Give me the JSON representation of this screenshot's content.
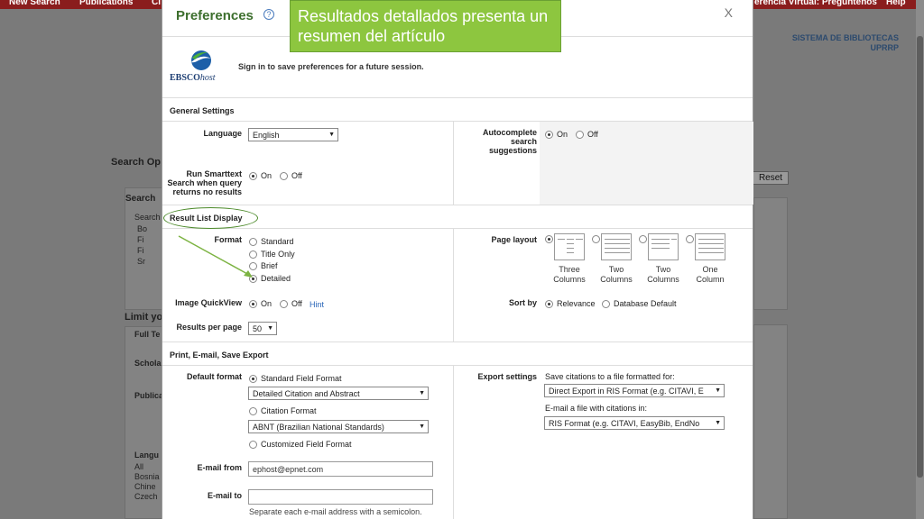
{
  "background": {
    "top_nav": [
      "New Search",
      "Publications",
      "Ci",
      "erencia Virtual: Pregúntenos",
      "Help"
    ],
    "system_name": [
      "SISTEMA DE BIBLIOTECAS",
      "UPRRP"
    ],
    "search_options_heading": "Search Op",
    "search_label": "Search",
    "search_modes": [
      "Search",
      "Bo",
      "Fi",
      "Fi",
      "Sr"
    ],
    "reset_label": "Reset",
    "limit_heading": "Limit yo",
    "limits": [
      "Full Te",
      "Schola",
      "Publica"
    ],
    "language_label": "Langu",
    "languages": [
      "All",
      "Bosnia",
      "Chine",
      "Czech"
    ]
  },
  "modal": {
    "title": "Preferences",
    "help": "?",
    "close": "X",
    "logo_main": "EBSCO",
    "logo_sub": "host",
    "signin_text": "Sign in to save preferences for a future session.",
    "general": {
      "title": "General Settings",
      "language_label": "Language",
      "language_value": "English",
      "autocomplete_label": [
        "Autocomplete",
        "search",
        "suggestions"
      ],
      "autocomplete_on": "On",
      "autocomplete_off": "Off",
      "smarttext_label": [
        "Run Smarttext",
        "Search when query",
        "returns no results"
      ],
      "smarttext_on": "On",
      "smarttext_off": "Off"
    },
    "result_list": {
      "title": "Result List Display",
      "format_label": "Format",
      "formats": [
        "Standard",
        "Title Only",
        "Brief",
        "Detailed"
      ],
      "page_layout_label": "Page layout",
      "layouts": [
        [
          "Three",
          "Columns"
        ],
        [
          "Two",
          "Columns"
        ],
        [
          "Two",
          "Columns"
        ],
        [
          "One",
          "Column"
        ]
      ],
      "quickview_label": "Image QuickView",
      "quickview_on": "On",
      "quickview_off": "Off",
      "hint": "Hint",
      "sort_label": "Sort by",
      "sort_relevance": "Relevance",
      "sort_database": "Database Default",
      "results_label": "Results per page",
      "results_value": "50"
    },
    "print": {
      "title": "Print, E-mail, Save Export",
      "default_format_label": "Default format",
      "standard_field": "Standard Field Format",
      "standard_select": "Detailed Citation and Abstract",
      "citation_format": "Citation Format",
      "citation_select": "ABNT (Brazilian National Standards)",
      "customized": "Customized Field Format",
      "export_label": "Export settings",
      "save_citations_text": "Save citations to a file formatted for:",
      "save_select": "Direct Export in RIS Format (e.g. CITAVI, E",
      "email_citations_text": "E-mail a file with citations in:",
      "email_select": "RIS Format (e.g. CITAVI, EasyBib, EndNo",
      "email_from_label": "E-mail from",
      "email_from_value": "ephost@epnet.com",
      "email_to_label": "E-mail to",
      "email_to_value": "",
      "email_hint": "Separate each e-mail address with a semicolon."
    }
  },
  "annotation": {
    "callout_text": "Resultados detallados presenta un resumen del artículo"
  },
  "colors": {
    "title_green": "#3d6f2e",
    "callout_green": "#8dc63f",
    "nav_red": "#8a1d1d",
    "link_blue": "#2a66b8"
  }
}
